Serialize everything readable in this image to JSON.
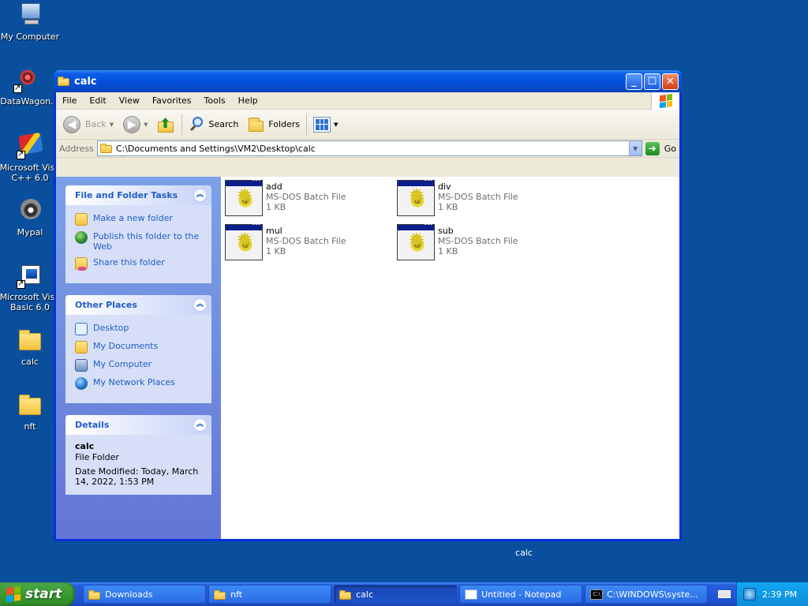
{
  "desktop": {
    "icons": [
      {
        "label": "My Computer"
      },
      {
        "label": "DataWagon."
      },
      {
        "label": "Microsoft Visu C++ 6.0"
      },
      {
        "label": "Mypal"
      },
      {
        "label": "Microsoft Visu Basic 6.0"
      },
      {
        "label": "calc"
      },
      {
        "label": "nft"
      }
    ],
    "stray_label": "calc"
  },
  "window": {
    "title": "calc",
    "menu": [
      "File",
      "Edit",
      "View",
      "Favorites",
      "Tools",
      "Help"
    ],
    "toolbar": {
      "back": "Back",
      "search": "Search",
      "folders": "Folders"
    },
    "address": {
      "label": "Address",
      "value": "C:\\Documents and Settings\\VM2\\Desktop\\calc",
      "go": "Go"
    },
    "taskpane": {
      "file_tasks": {
        "title": "File and Folder Tasks",
        "items": [
          "Make a new folder",
          "Publish this folder to the Web",
          "Share this folder"
        ]
      },
      "other_places": {
        "title": "Other Places",
        "items": [
          "Desktop",
          "My Documents",
          "My Computer",
          "My Network Places"
        ]
      },
      "details": {
        "title": "Details",
        "name": "calc",
        "type": "File Folder",
        "modified": "Date Modified: Today, March 14, 2022, 1:53 PM"
      }
    },
    "files": [
      {
        "name": "add",
        "type": "MS-DOS Batch File",
        "size": "1 KB"
      },
      {
        "name": "div",
        "type": "MS-DOS Batch File",
        "size": "1 KB"
      },
      {
        "name": "mul",
        "type": "MS-DOS Batch File",
        "size": "1 KB"
      },
      {
        "name": "sub",
        "type": "MS-DOS Batch File",
        "size": "1 KB"
      }
    ]
  },
  "taskbar": {
    "start": "start",
    "tasks": [
      {
        "label": "Downloads"
      },
      {
        "label": "nft"
      },
      {
        "label": "calc"
      },
      {
        "label": "Untitled - Notepad"
      },
      {
        "label": "C:\\WINDOWS\\syste..."
      }
    ],
    "clock": "2:39 PM"
  }
}
